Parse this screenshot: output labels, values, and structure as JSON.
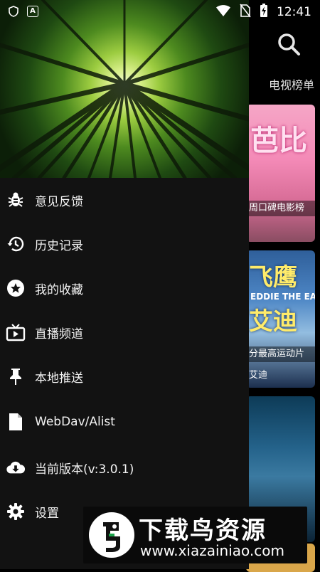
{
  "status_bar": {
    "left_icons": [
      "shield-icon",
      "a-badge-icon"
    ],
    "right_icons": [
      "wifi-icon",
      "no-sim-icon",
      "battery-charging-icon"
    ],
    "time": "12:41"
  },
  "background_app": {
    "tab_label": "电视榜单",
    "posters": [
      {
        "title": "芭比",
        "caption": "周口碑电影榜"
      },
      {
        "title": "飞鹰",
        "subtitle": "EDDIE THE EAGLE",
        "title2": "艾迪",
        "caption": "分最高运动片",
        "caption2": "艾迪"
      },
      {
        "title": ""
      },
      {
        "title": ""
      }
    ]
  },
  "drawer": {
    "menu": [
      {
        "icon": "bug-icon",
        "label": "意见反馈"
      },
      {
        "icon": "history-icon",
        "label": "历史记录"
      },
      {
        "icon": "star-icon",
        "label": "我的收藏"
      },
      {
        "icon": "tv-icon",
        "label": "直播频道"
      },
      {
        "icon": "pin-icon",
        "label": "本地推送"
      },
      {
        "icon": "file-icon",
        "label": "WebDav/Alist"
      },
      {
        "icon": "cloud-download-icon",
        "label": "当前版本(v:3.0.1)"
      },
      {
        "icon": "gear-icon",
        "label": "设置"
      }
    ]
  },
  "watermark": {
    "title": "下载鸟资源",
    "url": "www.xiazainiao.com"
  }
}
